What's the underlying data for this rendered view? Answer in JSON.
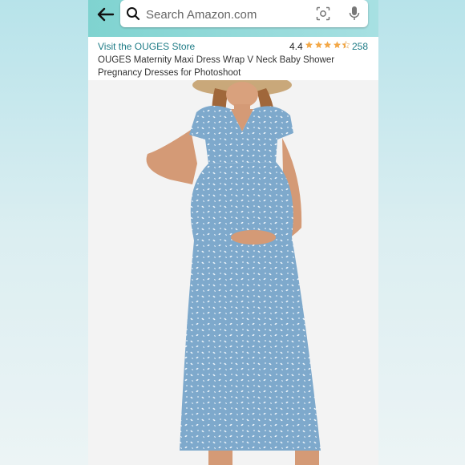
{
  "search": {
    "placeholder": "Search Amazon.com"
  },
  "icons": {
    "back": "back-arrow-icon",
    "search": "search-icon",
    "camera": "camera-scan-icon",
    "mic": "microphone-icon"
  },
  "product": {
    "store_link": "Visit the OUGES Store",
    "rating": "4.4",
    "stars": 4.4,
    "review_count": "258",
    "title": "OUGES Maternity Maxi Dress Wrap V Neck Baby Shower Pregnancy Dresses for Photoshoot"
  },
  "colors": {
    "link": "#1d7b86",
    "star": "#f3a847",
    "header_bar": "#8fd7d6",
    "dress": "#7ea9cc"
  }
}
